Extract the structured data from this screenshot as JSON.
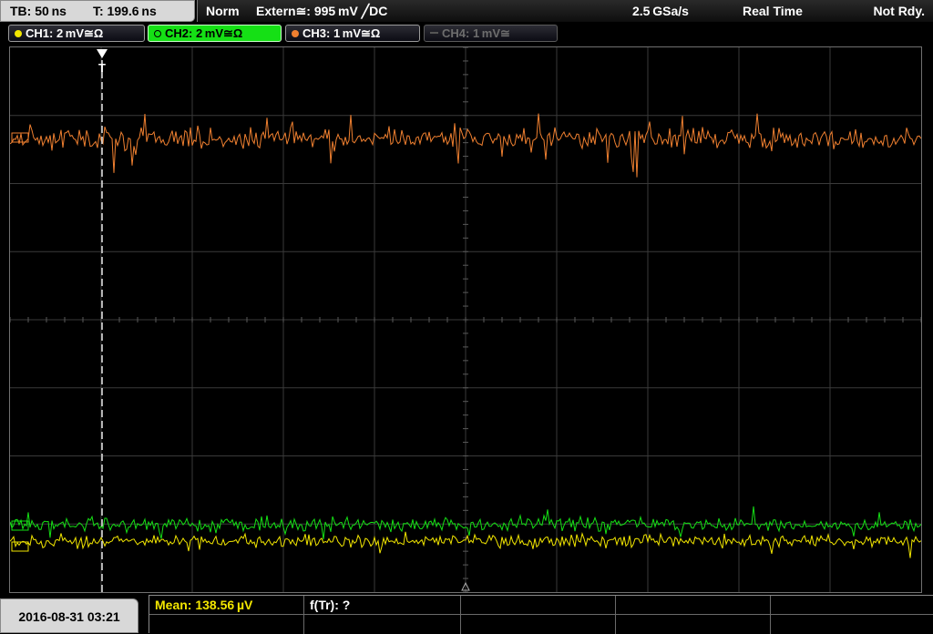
{
  "header": {
    "timebase": "TB: 50 ns",
    "trigger_time": "T: 199.6 ns",
    "mode": "Norm",
    "trigger_source": "Extern≅: 995 mV ╱DC",
    "sample_rate": "2.5 GSa/s",
    "acq_mode": "Real Time",
    "status": "Not Rdy."
  },
  "channels": [
    {
      "id": "CH1",
      "label": "CH1: 2 mV≅Ω",
      "color": "#f2e600",
      "active": false,
      "enabled": true
    },
    {
      "id": "CH2",
      "label": "CH2: 2 mV≅Ω",
      "color": "#15e015",
      "active": true,
      "enabled": true
    },
    {
      "id": "CH3",
      "label": "CH3: 1 mV≅Ω",
      "color": "#f08030",
      "active": false,
      "enabled": true
    },
    {
      "id": "CH4",
      "label": "CH4: 1 mV≅",
      "color": "#555555",
      "active": false,
      "enabled": false
    }
  ],
  "screen": {
    "trigger_marker": "T",
    "colors": {
      "grid": "#3a3a3a",
      "trigger_line": "#e8e8e8"
    }
  },
  "footer": {
    "datetime": "2016-08-31 03:21",
    "measurement_mean": "Mean: 138.56 µV",
    "measurement_ftr": "f(Tr): ?"
  }
}
